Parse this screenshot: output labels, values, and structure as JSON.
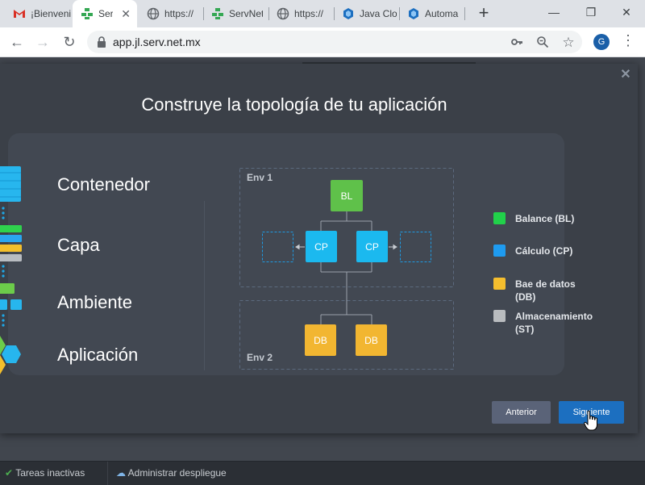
{
  "browser": {
    "tabs": [
      {
        "title": "¡Bienvenido",
        "icon": "gmail-icon"
      },
      {
        "title": "ServNet",
        "icon": "servnet-icon",
        "active": true
      },
      {
        "title": "https://",
        "icon": "globe-icon"
      },
      {
        "title": "ServNet",
        "icon": "servnet-icon"
      },
      {
        "title": "https://",
        "icon": "globe-icon"
      },
      {
        "title": "Java Cloud",
        "icon": "jelastic-icon"
      },
      {
        "title": "Automa",
        "icon": "jelastic-icon"
      }
    ],
    "url": "app.jl.serv.net.mx",
    "profile_initial": "G"
  },
  "modal": {
    "title": "Construye la topología de tu aplicación",
    "steps": [
      "Contenedor",
      "Capa",
      "Ambiente",
      "Aplicación"
    ],
    "diagram": {
      "env1_label": "Env 1",
      "env2_label": "Env 2",
      "nodes": {
        "bl": "BL",
        "cp": "CP",
        "db": "DB"
      }
    },
    "legend": [
      {
        "label": "Balance (BL)",
        "color": "#21d14a"
      },
      {
        "label": "Cálculo (CP)",
        "color": "#1e9bf0"
      },
      {
        "label": "Bae de datos (DB)",
        "color": "#f5be2e"
      },
      {
        "label": "Almacenamiento (ST)",
        "color": "#b9bcbf"
      }
    ],
    "buttons": {
      "prev": "Anterior",
      "next": "Siguiente"
    }
  },
  "bottom_bar": {
    "tasks": "Tareas inactivas",
    "deploy": "Administrar despliegue"
  },
  "colors": {
    "balancer": "#5fc14a",
    "compute": "#1bb9ef",
    "database": "#f2b631",
    "accent": "#1c6fc0"
  }
}
